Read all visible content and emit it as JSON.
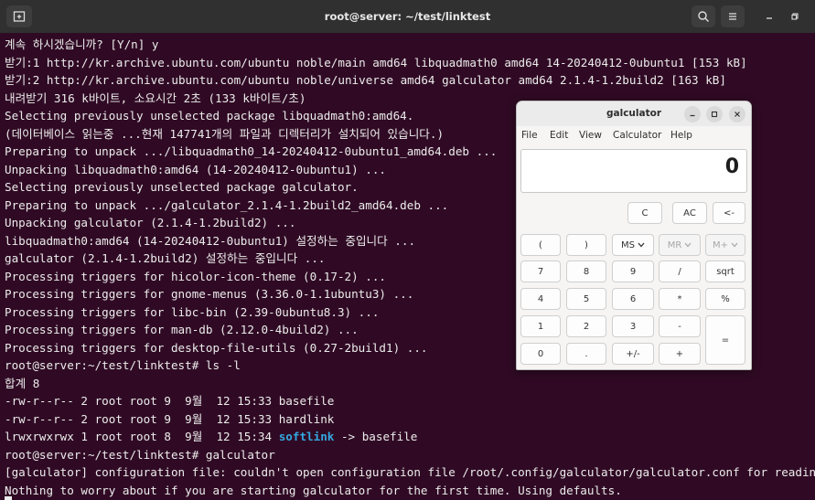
{
  "terminal_window": {
    "title": "root@server: ~/test/linktest"
  },
  "terminal": {
    "lines": [
      "계속 하시겠습니까? [Y/n] y",
      "받기:1 http://kr.archive.ubuntu.com/ubuntu noble/main amd64 libquadmath0 amd64 14-20240412-0ubuntu1 [153 kB]",
      "받기:2 http://kr.archive.ubuntu.com/ubuntu noble/universe amd64 galculator amd64 2.1.4-1.2build2 [163 kB]",
      "내려받기 316 k바이트, 소요시간 2초 (133 k바이트/초)",
      "Selecting previously unselected package libquadmath0:amd64.",
      "(데이터베이스 읽는중 ...현재 147741개의 파일과 디렉터리가 설치되어 있습니다.)",
      "Preparing to unpack .../libquadmath0_14-20240412-0ubuntu1_amd64.deb ...",
      "Unpacking libquadmath0:amd64 (14-20240412-0ubuntu1) ...",
      "Selecting previously unselected package galculator.",
      "Preparing to unpack .../galculator_2.1.4-1.2build2_amd64.deb ...",
      "Unpacking galculator (2.1.4-1.2build2) ...",
      "libquadmath0:amd64 (14-20240412-0ubuntu1) 설정하는 중입니다 ...",
      "galculator (2.1.4-1.2build2) 설정하는 중입니다 ...",
      "Processing triggers for hicolor-icon-theme (0.17-2) ...",
      "Processing triggers for gnome-menus (3.36.0-1.1ubuntu3) ...",
      "Processing triggers for libc-bin (2.39-0ubuntu8.3) ...",
      "Processing triggers for man-db (2.12.0-4build2) ...",
      "Processing triggers for desktop-file-utils (0.27-2build1) ...",
      "root@server:~/test/linktest# ls -l",
      "합계 8",
      "-rw-r--r-- 2 root root 9  9월  12 15:33 basefile",
      "-rw-r--r-- 2 root root 9  9월  12 15:33 hardlink"
    ],
    "ls_link_prefix": "lrwxrwxrwx 1 root root 8  9월  12 15:34 ",
    "ls_link_name": "softlink",
    "ls_link_target": " -> basefile",
    "tail_lines": [
      "root@server:~/test/linktest# galculator",
      "[galculator] configuration file: couldn't open configuration file /root/.config/galculator/galculator.conf for reading.",
      "Nothing to worry about if you are starting galculator for the first time. Using defaults."
    ]
  },
  "galculator": {
    "title": "galculator",
    "menu": [
      "File",
      "Edit",
      "View",
      "Calculator",
      "Help"
    ],
    "display_value": "0",
    "keys": {
      "c": "C",
      "ac": "AC",
      "back": "<-",
      "lparen": "(",
      "rparen": ")",
      "ms": "MS",
      "mr": "MR",
      "mplus": "M+",
      "k7": "7",
      "k8": "8",
      "k9": "9",
      "div": "/",
      "sqrt": "sqrt",
      "k4": "4",
      "k5": "5",
      "k6": "6",
      "mul": "*",
      "pct": "%",
      "k1": "1",
      "k2": "2",
      "k3": "3",
      "minus": "-",
      "eq": "=",
      "k0": "0",
      "dot": ".",
      "sign": "+/-",
      "plus": "+"
    }
  },
  "colors": {
    "terminal_bg": "#300a24",
    "titlebar_bg": "#303030",
    "link_color": "#34a7e0"
  }
}
